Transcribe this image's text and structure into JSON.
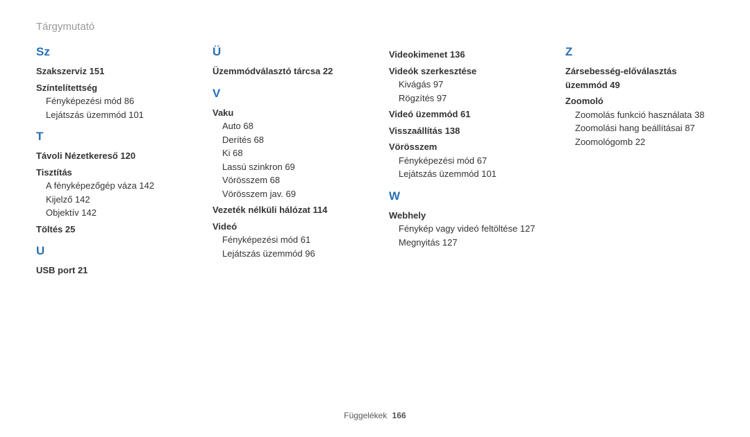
{
  "title": "Tárgymutató",
  "footer": {
    "label": "Függelékek",
    "page": "166"
  },
  "cols": [
    [
      {
        "t": "letter",
        "v": "Sz"
      },
      {
        "t": "bold",
        "v": "Szakszerviz  151"
      },
      {
        "t": "bold",
        "v": "Színtelítettség"
      },
      {
        "t": "sub",
        "v": "Fényképezési mód  86"
      },
      {
        "t": "sub",
        "v": "Lejátszás üzemmód  101"
      },
      {
        "t": "letter",
        "v": "T"
      },
      {
        "t": "bold",
        "v": "Távoli Nézetkereső  120"
      },
      {
        "t": "bold",
        "v": "Tisztítás"
      },
      {
        "t": "sub",
        "v": "A fényképezőgép váza  142"
      },
      {
        "t": "sub",
        "v": "Kijelző  142"
      },
      {
        "t": "sub",
        "v": "Objektív  142"
      },
      {
        "t": "bold",
        "v": "Töltés  25"
      },
      {
        "t": "letter",
        "v": "U"
      },
      {
        "t": "bold",
        "v": "USB port  21"
      }
    ],
    [
      {
        "t": "letter",
        "v": "Ü"
      },
      {
        "t": "bold",
        "v": "Üzemmódválasztó tárcsa  22"
      },
      {
        "t": "letter",
        "v": "V"
      },
      {
        "t": "bold",
        "v": "Vaku"
      },
      {
        "t": "sub",
        "v": "Auto  68"
      },
      {
        "t": "sub",
        "v": "Derítés  68"
      },
      {
        "t": "sub",
        "v": "Ki  68"
      },
      {
        "t": "sub",
        "v": "Lassú szinkron  69"
      },
      {
        "t": "sub",
        "v": "Vörösszem  68"
      },
      {
        "t": "sub",
        "v": "Vörösszem jav.  69"
      },
      {
        "t": "bold",
        "v": "Vezeték nélküli hálózat  114"
      },
      {
        "t": "bold",
        "v": "Videó"
      },
      {
        "t": "sub",
        "v": "Fényképezési mód  61"
      },
      {
        "t": "sub",
        "v": "Lejátszás üzemmód  96"
      }
    ],
    [
      {
        "t": "bold",
        "v": "Videokimenet  136"
      },
      {
        "t": "bold",
        "v": "Videók szerkesztése"
      },
      {
        "t": "sub",
        "v": "Kivágás  97"
      },
      {
        "t": "sub",
        "v": "Rögzítés  97"
      },
      {
        "t": "bold",
        "v": "Videó üzemmód  61"
      },
      {
        "t": "bold",
        "v": "Visszaállítás  138"
      },
      {
        "t": "bold",
        "v": "Vörösszem"
      },
      {
        "t": "sub",
        "v": "Fényképezési mód  67"
      },
      {
        "t": "sub",
        "v": "Lejátszás üzemmód  101"
      },
      {
        "t": "letter",
        "v": "W"
      },
      {
        "t": "bold",
        "v": "Webhely"
      },
      {
        "t": "sub",
        "v": "Fénykép vagy videó feltöltése  127"
      },
      {
        "t": "sub",
        "v": "Megnyitás  127"
      }
    ],
    [
      {
        "t": "letter",
        "v": "Z"
      },
      {
        "t": "bold",
        "v": "Zársebesség-előválasztás üzemmód  49"
      },
      {
        "t": "bold",
        "v": "Zoomoló"
      },
      {
        "t": "sub",
        "v": "Zoomolás funkció használata  38"
      },
      {
        "t": "sub",
        "v": "Zoomolási hang beállításai  87"
      },
      {
        "t": "sub",
        "v": "Zoomológomb  22"
      }
    ]
  ]
}
